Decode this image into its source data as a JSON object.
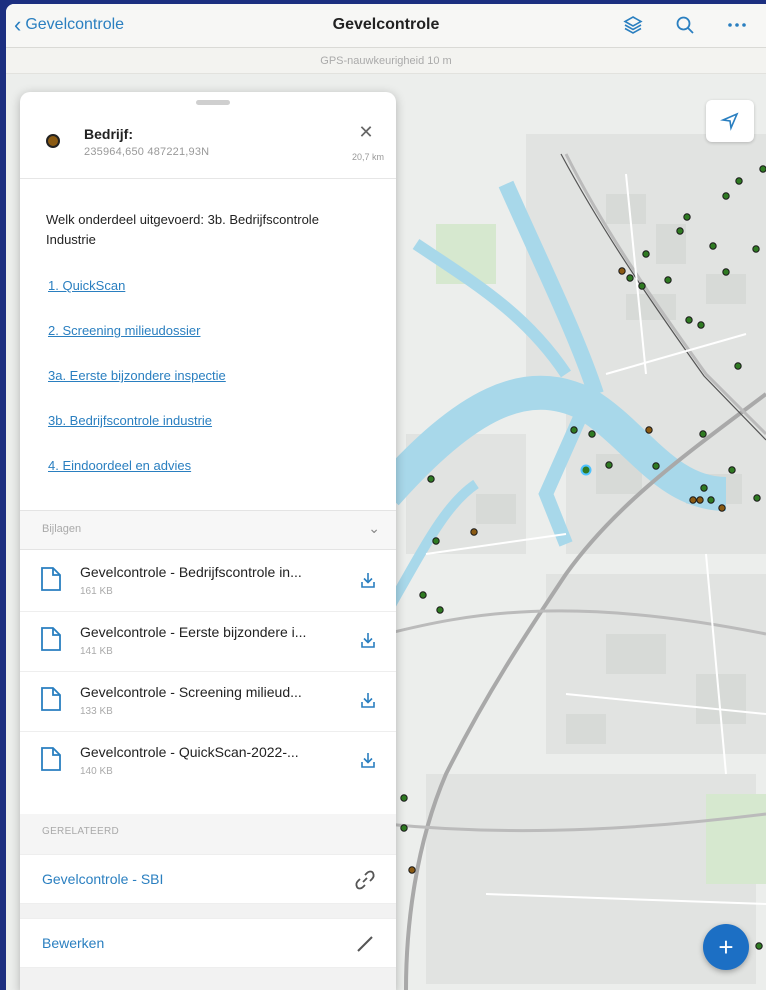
{
  "topbar": {
    "back_label": "Gevelcontrole",
    "title": "Gevelcontrole",
    "icons": [
      "layers-icon",
      "search-icon",
      "more-icon"
    ]
  },
  "gps_label": "GPS-nauwkeurigheid 10 m",
  "panel": {
    "title": "Bedrijf:",
    "coordinates": "235964,650 487221,93N",
    "distance": "20,7 km",
    "question": "Welk onderdeel uitgevoerd: 3b. Bedrijfscontrole Industrie",
    "links": [
      "1. QuickScan",
      "2. Screening milieudossier",
      "3a. Eerste bijzondere inspectie",
      "3b. Bedrijfscontrole industrie",
      "4. Eindoordeel en advies"
    ],
    "attachments_label": "Bijlagen",
    "attachments": [
      {
        "name": "Gevelcontrole - Bedrijfscontrole in...",
        "size": "161 KB"
      },
      {
        "name": "Gevelcontrole - Eerste bijzondere i...",
        "size": "141 KB"
      },
      {
        "name": "Gevelcontrole - Screening milieud...",
        "size": "133 KB"
      },
      {
        "name": "Gevelcontrole - QuickScan-2022-...",
        "size": "140 KB"
      }
    ],
    "related_label": "GERELATEERD",
    "related_item": "Gevelcontrole - SBI",
    "edit_label": "Bewerken"
  },
  "colors": {
    "accent": "#2a7fc0",
    "water": "#a8d8ea",
    "point_green": "#2f7a22",
    "point_brown": "#8a5a13",
    "frame": "#1c2f80"
  }
}
